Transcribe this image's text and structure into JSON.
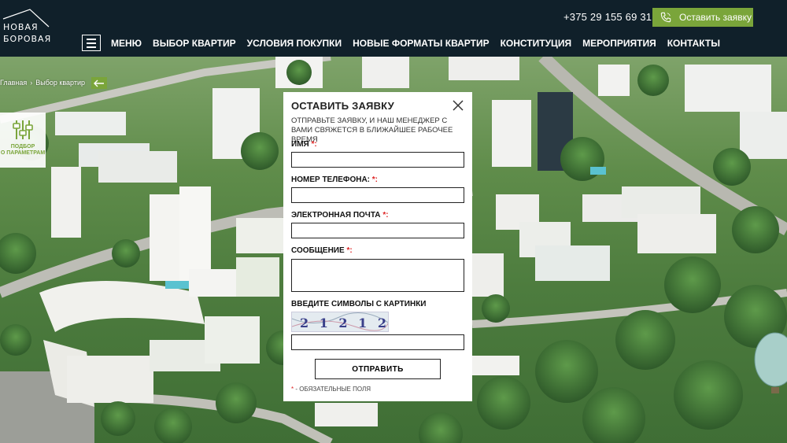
{
  "header": {
    "logo": {
      "line1": "Новая",
      "line2": "Боровая"
    },
    "phone": "+375 29 155 69 31",
    "cta_label": "Оставить заявку",
    "nav": [
      "Меню",
      "Выбор квартир",
      "Условия покупки",
      "Новые форматы квартир",
      "Конституция",
      "Мероприятия",
      "Контакты"
    ]
  },
  "breadcrumb": {
    "home": "Главная",
    "current": "Выбор квартир"
  },
  "filter": {
    "label_line1": "Подбор",
    "label_line2": "о параметрам"
  },
  "modal": {
    "title": "Оставить заявку",
    "subtitle": "Отправьте заявку, и наш менеджер с вами свяжется в ближайшее рабочее время",
    "fields": {
      "name": "Имя",
      "phone": "Номер телефона:",
      "email": "Электронная почта",
      "message": "Сообщение",
      "captcha": "Введите символы с картинки"
    },
    "required_mark": "*",
    "required_colon": "*:",
    "captcha_text": "2 1 2 1 2",
    "submit_label": "Отправить",
    "note_mark": "*",
    "note_text": " - обязательные поля"
  },
  "colors": {
    "accent": "#7aa53a",
    "header_bg": "#10202a",
    "required": "#dd2222"
  }
}
